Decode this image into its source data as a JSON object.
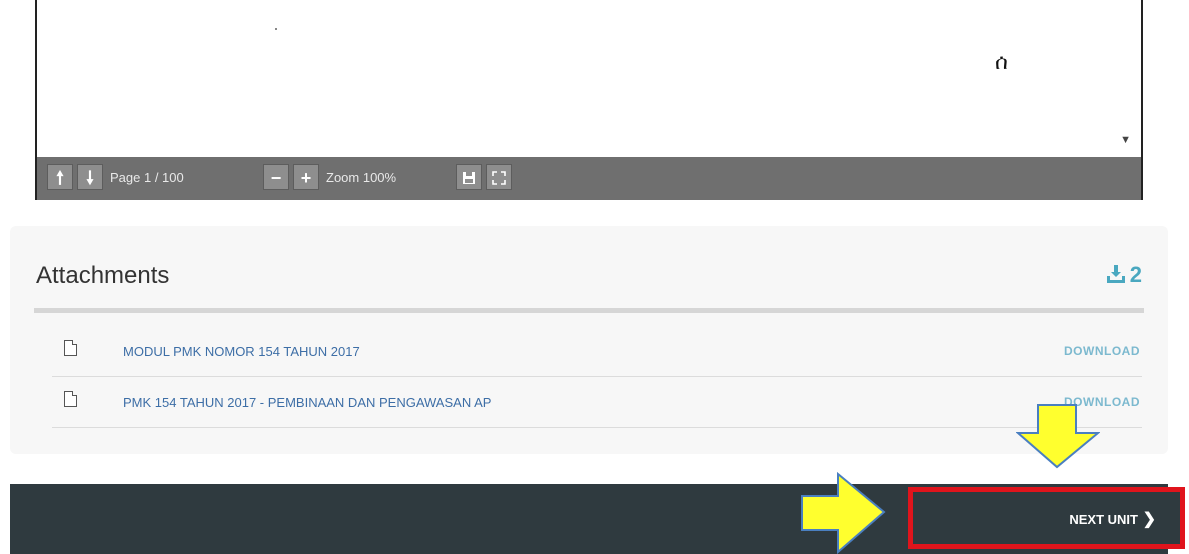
{
  "viewer": {
    "page_label": "Page 1 / 100",
    "zoom_label": "Zoom 100%",
    "page_glyph": "ሰ",
    "icons": {
      "prev": "arrow-up-icon",
      "next": "arrow-down-icon",
      "zoom_out": "minus-icon",
      "zoom_in": "plus-icon",
      "download": "save-icon",
      "fullscreen": "fullscreen-icon",
      "scroll_down": "caret-down-icon"
    }
  },
  "attachments": {
    "title": "Attachments",
    "count": "2",
    "count_icon": "download-icon",
    "items": [
      {
        "name": "MODUL PMK NOMOR 154 TAHUN 2017",
        "action": "DOWNLOAD",
        "icon": "pdf-file-icon"
      },
      {
        "name": "PMK 154 TAHUN 2017 - PEMBINAAN DAN PENGAWASAN AP",
        "action": "DOWNLOAD",
        "icon": "pdf-file-icon"
      }
    ]
  },
  "footer": {
    "next_label": "NEXT UNIT",
    "next_icon": "chevron-right-icon",
    "highlight_color": "#e0141c",
    "arrow_color": "#ffff2e"
  }
}
